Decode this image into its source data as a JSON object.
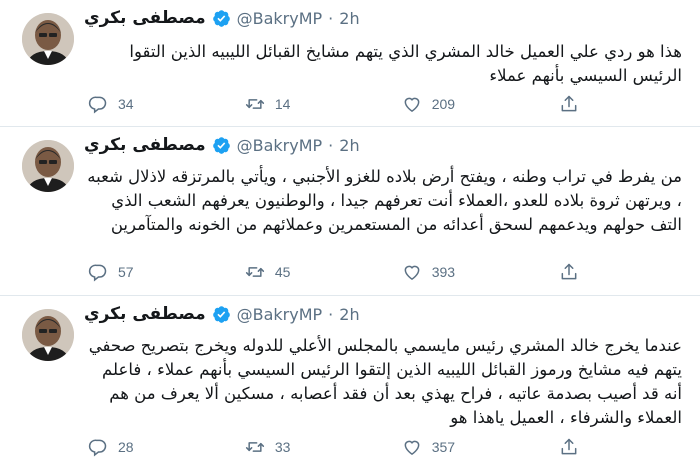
{
  "tweets": [
    {
      "author": {
        "name": "مصطفى بكري",
        "handle": "@BakryMP",
        "separator": "·",
        "time": "2h"
      },
      "text": "هذا هو ردي علي العميل خالد المشري الذي يتهم مشايخ القبائل الليبيه الذين التقوا الرئيس السيسي بأنهم عملاء",
      "replies": "34",
      "retweets": "14",
      "likes": "209"
    },
    {
      "author": {
        "name": "مصطفى بكري",
        "handle": "@BakryMP",
        "separator": "·",
        "time": "2h"
      },
      "text": "من يفرط في تراب وطنه ، ويفتح أرض بلاده للغزو الأجنبي ، ويأتي بالمرتزقه لاذلال شعبه ، ويرتهن ثروة بلاده للعدو ،العملاء أنت تعرفهم جيدا ، والوطنيون يعرفهم الشعب الذي التف حولهم ويدعمهم لسحق أعدائه من المستعمرين وعملائهم من الخونه والمتآمرين",
      "replies": "57",
      "retweets": "45",
      "likes": "393"
    },
    {
      "author": {
        "name": "مصطفى بكري",
        "handle": "@BakryMP",
        "separator": "·",
        "time": "2h"
      },
      "text": "عندما يخرج خالد المشري رئيس مايسمي بالمجلس الأعلي للدوله ويخرج بتصريح صحفي يتهم فيه مشايخ ورموز القبائل الليبيه الذين إلتقوا الرئيس السيسي بأنهم عملاء ، فاعلم أنه قد أصيب بصدمة عاتيه ، فراح يهذي بعد أن فقد أعصابه ، مسكين ألا يعرف من هم العملاء والشرفاء ، العميل ياهذا هو",
      "replies": "28",
      "retweets": "33",
      "likes": "357"
    }
  ],
  "icons": {
    "reply": "reply-icon",
    "retweet": "retweet-icon",
    "like": "like-icon",
    "share": "share-icon",
    "verified": "verified-badge-icon"
  },
  "colors": {
    "verified": "#1da1f2",
    "secondary_text": "#5b7083",
    "divider": "#e1e8ed"
  }
}
